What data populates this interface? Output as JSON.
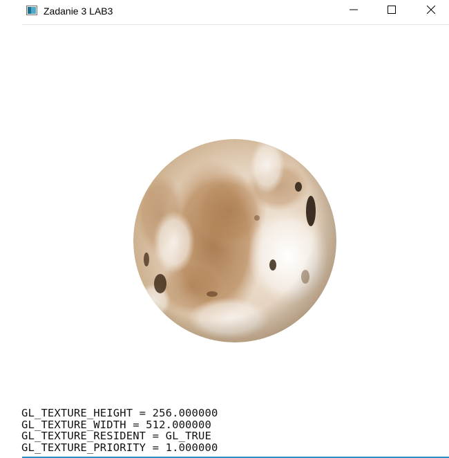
{
  "window": {
    "title": "Zadanie 3 LAB3",
    "app_icon": "opengl-window-icon",
    "controls": {
      "minimize_icon": "minimize-icon",
      "maximize_icon": "maximize-icon",
      "close_icon": "close-icon"
    }
  },
  "viewport": {
    "object": "textured-sphere",
    "texture_params": [
      "GL_TEXTURE_HEIGHT = 256.000000",
      "GL_TEXTURE_WIDTH = 512.000000",
      "GL_TEXTURE_RESIDENT = GL_TRUE",
      "GL_TEXTURE_PRIORITY = 1.000000"
    ]
  },
  "colors": {
    "background": "#ffffff",
    "sphere_light": "#f4efe8",
    "sphere_brown": "#b58656",
    "sphere_dark": "#2a1d12",
    "accent_line": "#2a8fbf"
  }
}
